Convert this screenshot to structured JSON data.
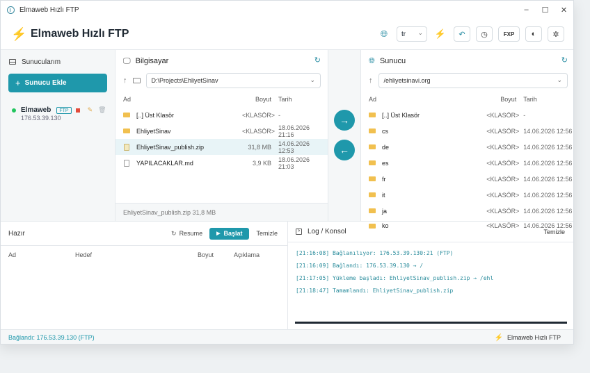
{
  "window": {
    "title": "Elmaweb Hızlı FTP",
    "controls": [
      "–",
      "☐",
      "✕"
    ]
  },
  "header": {
    "title": "Elmaweb Hızlı FTP",
    "language": "tr",
    "fxp_label": "FXP"
  },
  "sidebar": {
    "title": "Sunucularım",
    "add_button": "Sunucu Ekle",
    "servers": [
      {
        "name": "Elmaweb",
        "protocol": "FTP",
        "host": "176.53.39.130",
        "status": "connected"
      }
    ]
  },
  "local": {
    "title": "Bilgisayar",
    "path": "D:\\Projects\\EhliyetSinav",
    "columns": {
      "name": "Ad",
      "size": "Boyut",
      "date": "Tarih"
    },
    "files": [
      {
        "name": "[..] Üst Klasör",
        "size": "<KLASÖR>",
        "date": "-",
        "type": "folder"
      },
      {
        "name": "EhliyetSinav",
        "size": "<KLASÖR>",
        "date": "18.06.2026 21:16",
        "type": "folder"
      },
      {
        "name": "EhliyetSinav_publish.zip",
        "size": "31,8 MB",
        "date": "14.06.2026 12:53",
        "type": "zip",
        "selected": true
      },
      {
        "name": "YAPILACAKLAR.md",
        "size": "3,9 KB",
        "date": "18.06.2026 21:03",
        "type": "doc"
      }
    ],
    "footer": "EhliyetSinav_publish.zip  31,8 MB"
  },
  "remote": {
    "title": "Sunucu",
    "path": "/ehliyetsinavi.org",
    "columns": {
      "name": "Ad",
      "size": "Boyut",
      "date": "Tarih"
    },
    "files": [
      {
        "name": "[..] Üst Klasör",
        "size": "<KLASÖR>",
        "date": "-"
      },
      {
        "name": "cs",
        "size": "<KLASÖR>",
        "date": "14.06.2026 12:56"
      },
      {
        "name": "de",
        "size": "<KLASÖR>",
        "date": "14.06.2026 12:56"
      },
      {
        "name": "es",
        "size": "<KLASÖR>",
        "date": "14.06.2026 12:56"
      },
      {
        "name": "fr",
        "size": "<KLASÖR>",
        "date": "14.06.2026 12:56"
      },
      {
        "name": "it",
        "size": "<KLASÖR>",
        "date": "14.06.2026 12:56"
      },
      {
        "name": "ja",
        "size": "<KLASÖR>",
        "date": "14.06.2026 12:56"
      },
      {
        "name": "ko",
        "size": "<KLASÖR>",
        "date": "14.06.2026 12:56"
      }
    ]
  },
  "transfer": {
    "upload": "→",
    "download": "←"
  },
  "queue": {
    "status": "Hazır",
    "resume": "Resume",
    "start": "Başlat",
    "clear": "Temizle",
    "columns": {
      "name": "Ad",
      "target": "Hedef",
      "size": "Boyut",
      "description": "Açıklama"
    }
  },
  "log": {
    "title": "Log / Konsol",
    "clear": "Temizle",
    "lines": [
      "[21:16:08] Bağlanılıyor: 176.53.39.130:21 (FTP)",
      "[21:16:09] Bağlandı: 176.53.39.130 → /",
      "[21:17:05] Yükleme başladı: EhliyetSinav_publish.zip → /ehl",
      "[21:18:47] Tamamlandı: EhliyetSinav_publish.zip"
    ]
  },
  "statusbar": {
    "text": "Bağlandı: 176.53.39.130 (FTP)",
    "brand": "Elmaweb Hızlı FTP"
  },
  "colors": {
    "accent": "#1f98ab",
    "bolt": "#f5a623",
    "folder": "#f1c04f",
    "connected": "#22c55e",
    "stop": "#e24b3b"
  }
}
